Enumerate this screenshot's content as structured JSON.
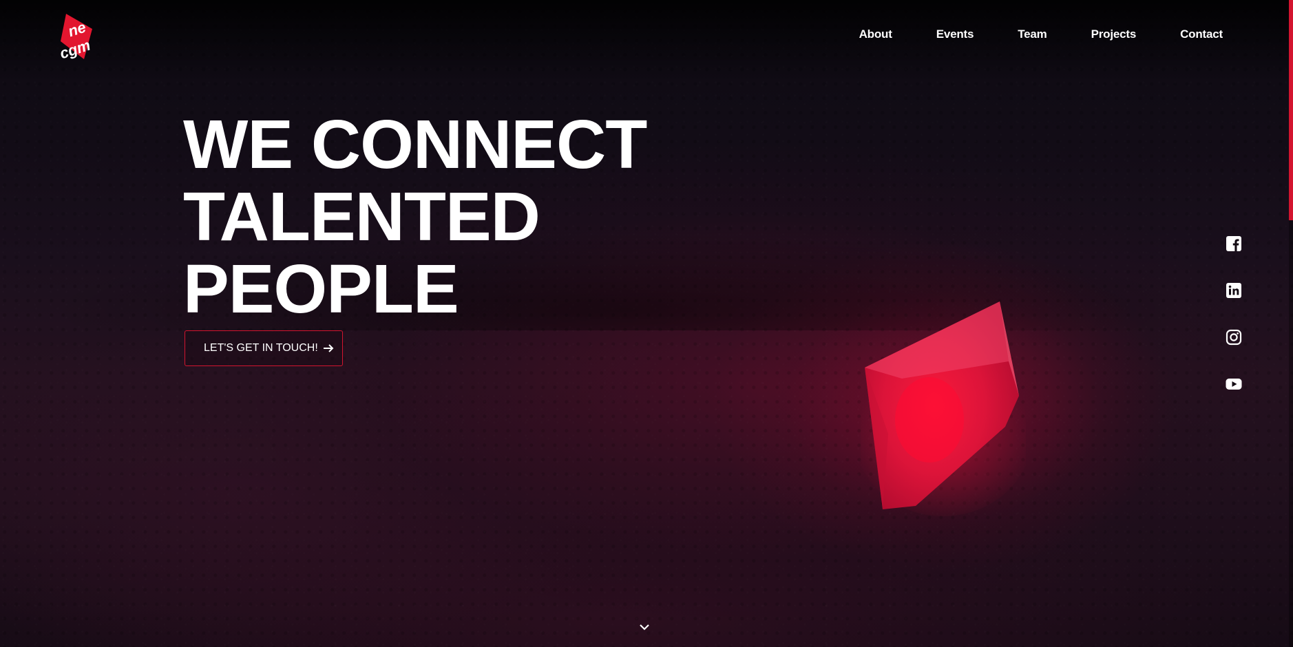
{
  "logo": {
    "line1": "ne",
    "line2": "cgm",
    "icon": "necgm-logo-icon",
    "accent": "#e2162f"
  },
  "nav": {
    "items": [
      {
        "label": "About"
      },
      {
        "label": "Events"
      },
      {
        "label": "Team"
      },
      {
        "label": "Projects"
      },
      {
        "label": "Contact"
      }
    ]
  },
  "hero": {
    "title_lines": [
      "WE CONNECT",
      "TALENTED",
      "PEOPLE"
    ],
    "cta_label": "LET'S GET IN TOUCH!",
    "cta_icon": "arrow-right-icon"
  },
  "social": {
    "items": [
      {
        "name": "facebook",
        "icon": "facebook-icon"
      },
      {
        "name": "linkedin",
        "icon": "linkedin-icon"
      },
      {
        "name": "instagram",
        "icon": "instagram-icon"
      },
      {
        "name": "youtube",
        "icon": "youtube-icon"
      }
    ]
  },
  "scroll": {
    "icon": "chevron-down-icon",
    "progress": 0.34
  },
  "colors": {
    "accent": "#d3142f",
    "text": "#ffffff",
    "background": "#140c14"
  }
}
